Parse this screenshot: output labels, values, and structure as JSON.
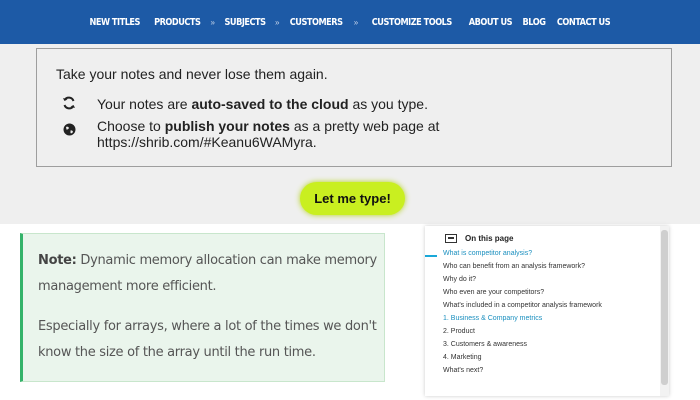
{
  "nav": {
    "items": [
      "NEW TITLES",
      "PRODUCTS",
      "SUBJECTS",
      "CUSTOMERS",
      "CUSTOMIZE TOOLS",
      "ABOUT US",
      "BLOG",
      "CONTACT US"
    ],
    "separator": "»"
  },
  "notes_box": {
    "intro": "Take your notes and never lose them again.",
    "feature1_pre": "Your notes are ",
    "feature1_bold": "auto-saved to the cloud",
    "feature1_post": " as you type.",
    "feature1_icon": "sync-icon",
    "feature2_pre": "Choose to ",
    "feature2_bold": "publish your notes",
    "feature2_post": " as a pretty web page at",
    "feature2_url": "https://shrib.com/#Keanu6WAMyra.",
    "feature2_icon": "globe-icon"
  },
  "cta": {
    "label": "Let me type!",
    "color": "#c9ef20"
  },
  "note": {
    "label": "Note:",
    "line1": " Dynamic memory allocation can make memory management more efficient.",
    "line2": "Especially for arrays, where a lot of the times we don't know the size of the array until the run time."
  },
  "toc": {
    "title": "On this page",
    "items": [
      "What is competitor analysis?",
      "Who can benefit from an analysis framework?",
      "Why do it?",
      "Who even are your competitors?",
      "What's included in a competitor analysis framework",
      "1. Business & Company metrics",
      "2. Product",
      "3. Customers & awareness",
      "4. Marketing",
      "What's next?"
    ]
  },
  "colors": {
    "nav_bg": "#1d5aa6",
    "note_border": "#34b36a",
    "toc_active": "#1a8fbf"
  }
}
